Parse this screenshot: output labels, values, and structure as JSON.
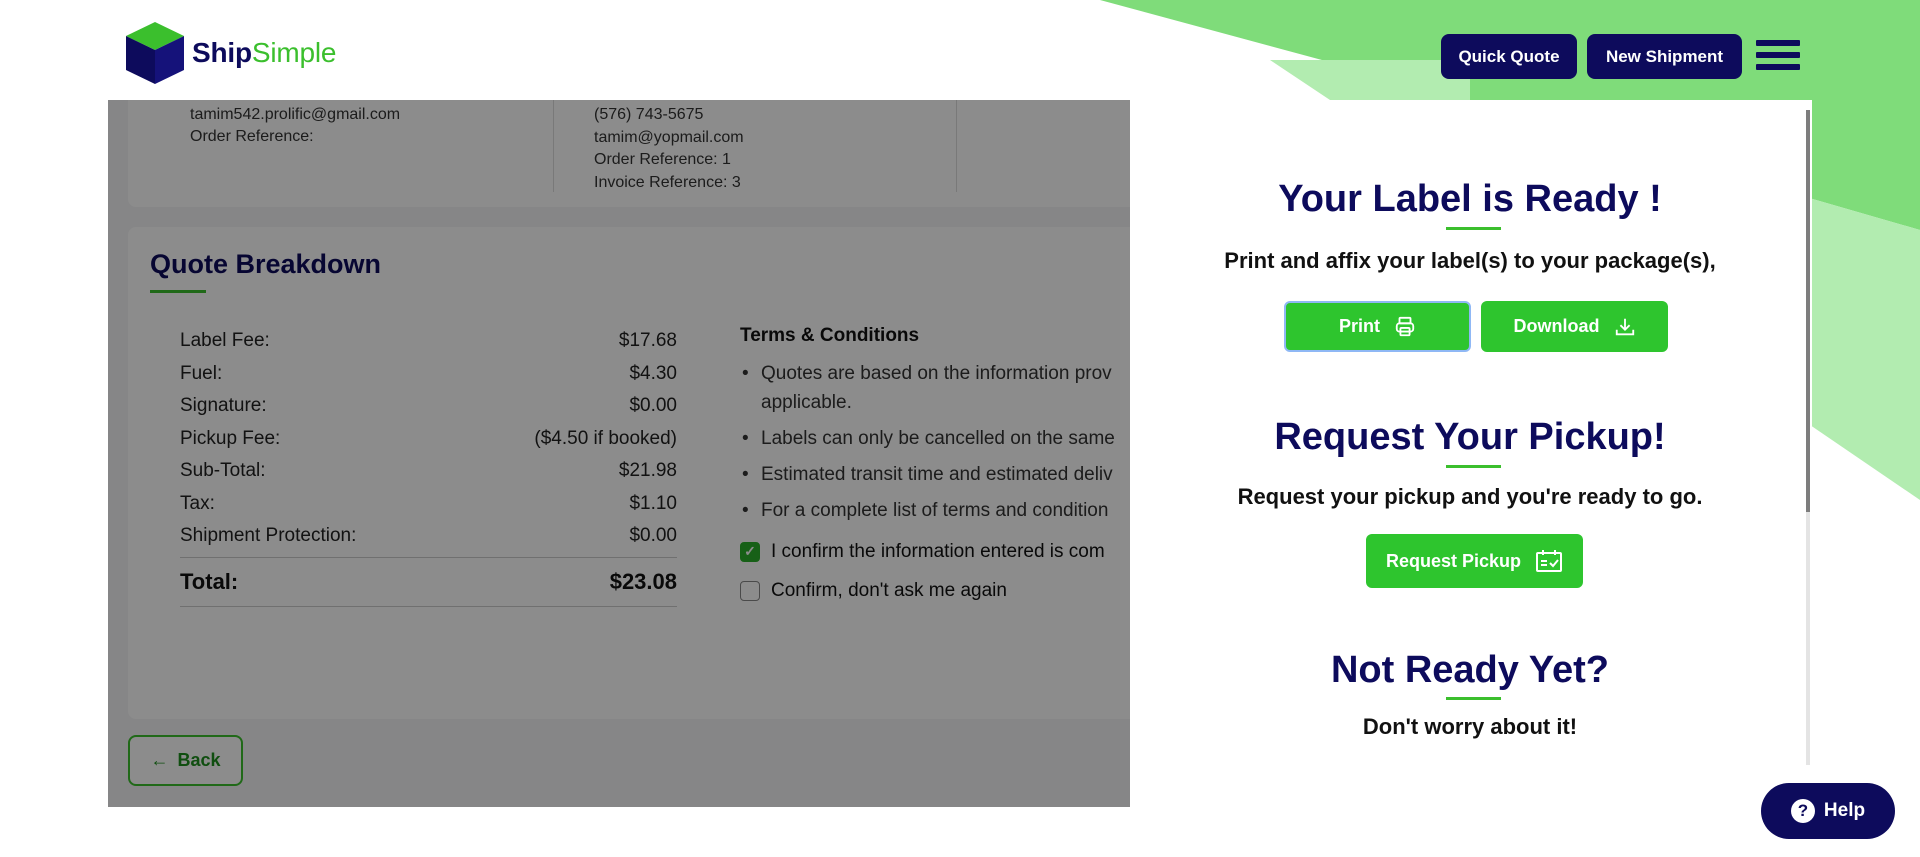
{
  "brand": {
    "name_part1": "Ship",
    "name_part2": "Simple",
    "primary_color": "#0d0b5c",
    "accent_color": "#3bbf2d"
  },
  "header": {
    "quick_quote_label": "Quick Quote",
    "new_shipment_label": "New Shipment",
    "menu_icon": "hamburger-menu-icon"
  },
  "sender": {
    "email": "tamim542.prolific@gmail.com",
    "order_reference": "Order Reference:"
  },
  "recipient": {
    "phone": "(576) 743-5675",
    "email": "tamim@yopmail.com",
    "order_reference": "Order Reference: 1",
    "invoice_reference": "Invoice Reference: 3"
  },
  "quote": {
    "title": "Quote Breakdown",
    "rows": [
      {
        "label": "Label Fee:",
        "value": "$17.68"
      },
      {
        "label": "Fuel:",
        "value": "$4.30"
      },
      {
        "label": "Signature:",
        "value": "$0.00"
      },
      {
        "label": "Pickup Fee:",
        "value": "($4.50 if booked)"
      },
      {
        "label": "Sub-Total:",
        "value": "$21.98"
      },
      {
        "label": "Tax:",
        "value": "$1.10"
      },
      {
        "label": "Shipment Protection:",
        "value": "$0.00"
      }
    ],
    "total_label": "Total:",
    "total_value": "$23.08"
  },
  "terms": {
    "title": "Terms & Conditions",
    "items": [
      "Quotes are based on the information prov",
      "applicable.",
      "Labels can only be cancelled on the same",
      "Estimated transit time and estimated deliv",
      "For a complete list of terms and condition"
    ],
    "confirm_label": "I confirm the information entered is com",
    "confirm_checked": true,
    "dont_ask_label": "Confirm, don't ask me again",
    "dont_ask_checked": false
  },
  "back_label": "Back",
  "modal": {
    "label_title": "Your Label is Ready !",
    "label_text": "Print and affix your label(s) to your package(s),",
    "print_label": "Print",
    "print_icon": "printer-icon",
    "download_label": "Download",
    "download_icon": "download-icon",
    "pickup_title": "Request Your Pickup!",
    "pickup_text": "Request your pickup and you're ready to go.",
    "pickup_button_label": "Request Pickup",
    "pickup_icon": "calendar-icon",
    "not_ready_title": "Not Ready Yet?",
    "not_ready_text": "Don't worry about it!"
  },
  "help_label": "Help"
}
